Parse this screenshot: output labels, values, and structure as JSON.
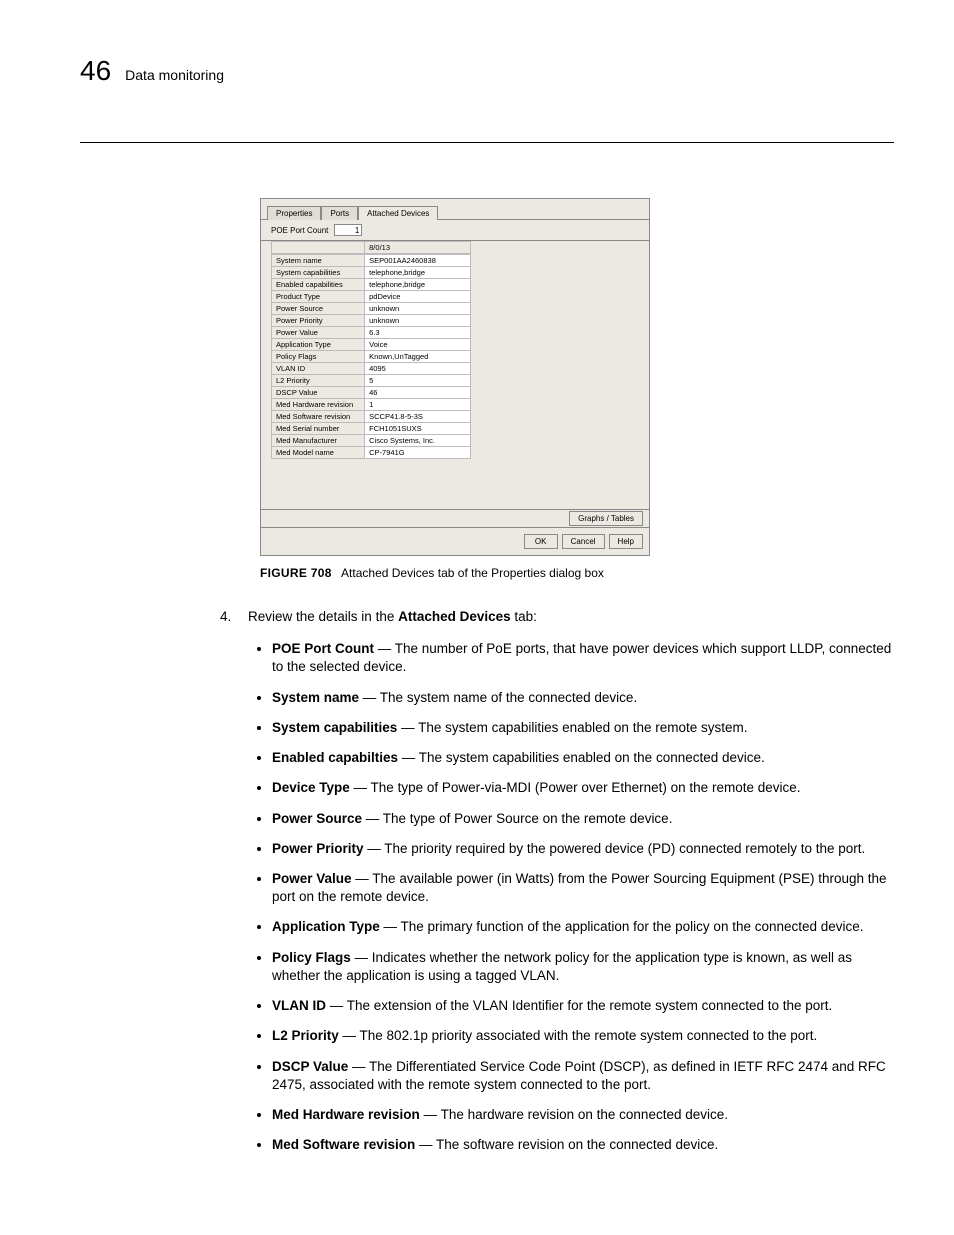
{
  "header": {
    "page_number": "46",
    "section_title": "Data monitoring"
  },
  "dialog": {
    "tabs": {
      "properties": "Properties",
      "ports": "Ports",
      "attached": "Attached Devices"
    },
    "count_label": "POE Port Count",
    "count_value": "1",
    "header_cell": "8/0/13",
    "rows": {
      "System name": "SEP001AA2460838",
      "System capabilities": "telephone,bridge",
      "Enabled capabilities": "telephone,bridge",
      "Product Type": "pdDevice",
      "Power Source": "unknown",
      "Power Priority": "unknown",
      "Power Value": "6.3",
      "Application Type": "Voice",
      "Policy Flags": "Known,UnTagged",
      "VLAN ID": "4095",
      "L2 Priority": "5",
      "DSCP Value": "46",
      "Med Hardware revision": "1",
      "Med Software revision": "SCCP41.8-5-3S",
      "Med Serial number": "FCH1051SUXS",
      "Med Manufacturer": "Cisco Systems, Inc.",
      "Med Model name": "CP-7941G"
    },
    "graphs_btn": "Graphs / Tables",
    "ok": "OK",
    "cancel": "Cancel",
    "help": "Help"
  },
  "caption": {
    "fig": "FIGURE 708",
    "text": "Attached Devices tab of the Properties dialog box"
  },
  "step": {
    "num": "4.",
    "text_a": "Review the details in the ",
    "bold": "Attached Devices",
    "text_b": " tab:"
  },
  "bullets": {
    "b0": {
      "term": "POE Port Count",
      "desc": " — The number of PoE ports, that have power devices which support LLDP, connected to the selected device."
    },
    "b1": {
      "term": "System name",
      "desc": " — The system name of the connected device."
    },
    "b2": {
      "term": "System capabilities",
      "desc": " — The system capabilities enabled on the remote system."
    },
    "b3": {
      "term": "Enabled capabilties",
      "desc": " — The system capabilities enabled on the connected device."
    },
    "b4": {
      "term": "Device Type",
      "desc": " — The type of Power-via-MDI (Power over Ethernet) on the remote device."
    },
    "b5": {
      "term": "Power Source",
      "desc": " — The type of Power Source on the remote device."
    },
    "b6": {
      "term": "Power Priority",
      "desc": " — The priority required by the powered device (PD) connected remotely to the port."
    },
    "b7": {
      "term": "Power Value",
      "desc": " — The available power (in Watts) from the Power Sourcing Equipment (PSE) through the port on the remote device."
    },
    "b8": {
      "term": "Application Type",
      "desc": " — The primary function of the application for the policy on the connected device."
    },
    "b9": {
      "term": "Policy Flags",
      "desc": " — Indicates whether the network policy for the application type is known, as well as whether the application is using a tagged VLAN."
    },
    "b10": {
      "term": "VLAN ID",
      "desc": " — The extension of the VLAN Identifier for the remote system connected to the port."
    },
    "b11": {
      "term": "L2 Priority",
      "desc": " — The 802.1p priority associated with the remote system connected to the port."
    },
    "b12": {
      "term": "DSCP Value",
      "desc": " — The Differentiated Service Code Point (DSCP), as defined in IETF RFC 2474 and RFC 2475, associated with the remote system connected to the port."
    },
    "b13": {
      "term": "Med Hardware revision",
      "desc": " — The hardware revision on the connected device."
    },
    "b14": {
      "term": "Med Software revision",
      "desc": " — The software revision on the connected device."
    }
  }
}
